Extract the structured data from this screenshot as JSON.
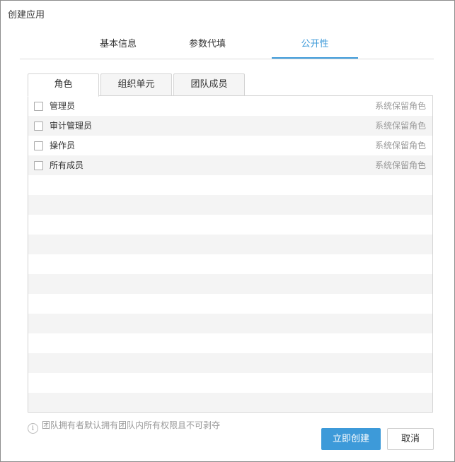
{
  "dialog": {
    "title": "创建应用"
  },
  "main_tabs": [
    {
      "label": "基本信息",
      "active": false
    },
    {
      "label": "参数代填",
      "active": false
    },
    {
      "label": "公开性",
      "active": true
    }
  ],
  "sub_tabs": [
    {
      "label": "角色",
      "active": true
    },
    {
      "label": "组织单元",
      "active": false
    },
    {
      "label": "团队成员",
      "active": false
    }
  ],
  "roles": [
    {
      "name": "管理员",
      "note": "系统保留角色",
      "checked": false
    },
    {
      "name": "审计管理员",
      "note": "系统保留角色",
      "checked": false
    },
    {
      "name": "操作员",
      "note": "系统保留角色",
      "checked": false
    },
    {
      "name": "所有成员",
      "note": "系统保留角色",
      "checked": false
    }
  ],
  "footer": {
    "note": "团队拥有者默认拥有团队内所有权限且不可剥夺",
    "create_label": "立即创建",
    "cancel_label": "取消"
  },
  "colors": {
    "accent": "#3d9ad9",
    "row_alt": "#f4f4f4",
    "muted_text": "#999999"
  },
  "icons": {
    "info": "info-icon"
  }
}
